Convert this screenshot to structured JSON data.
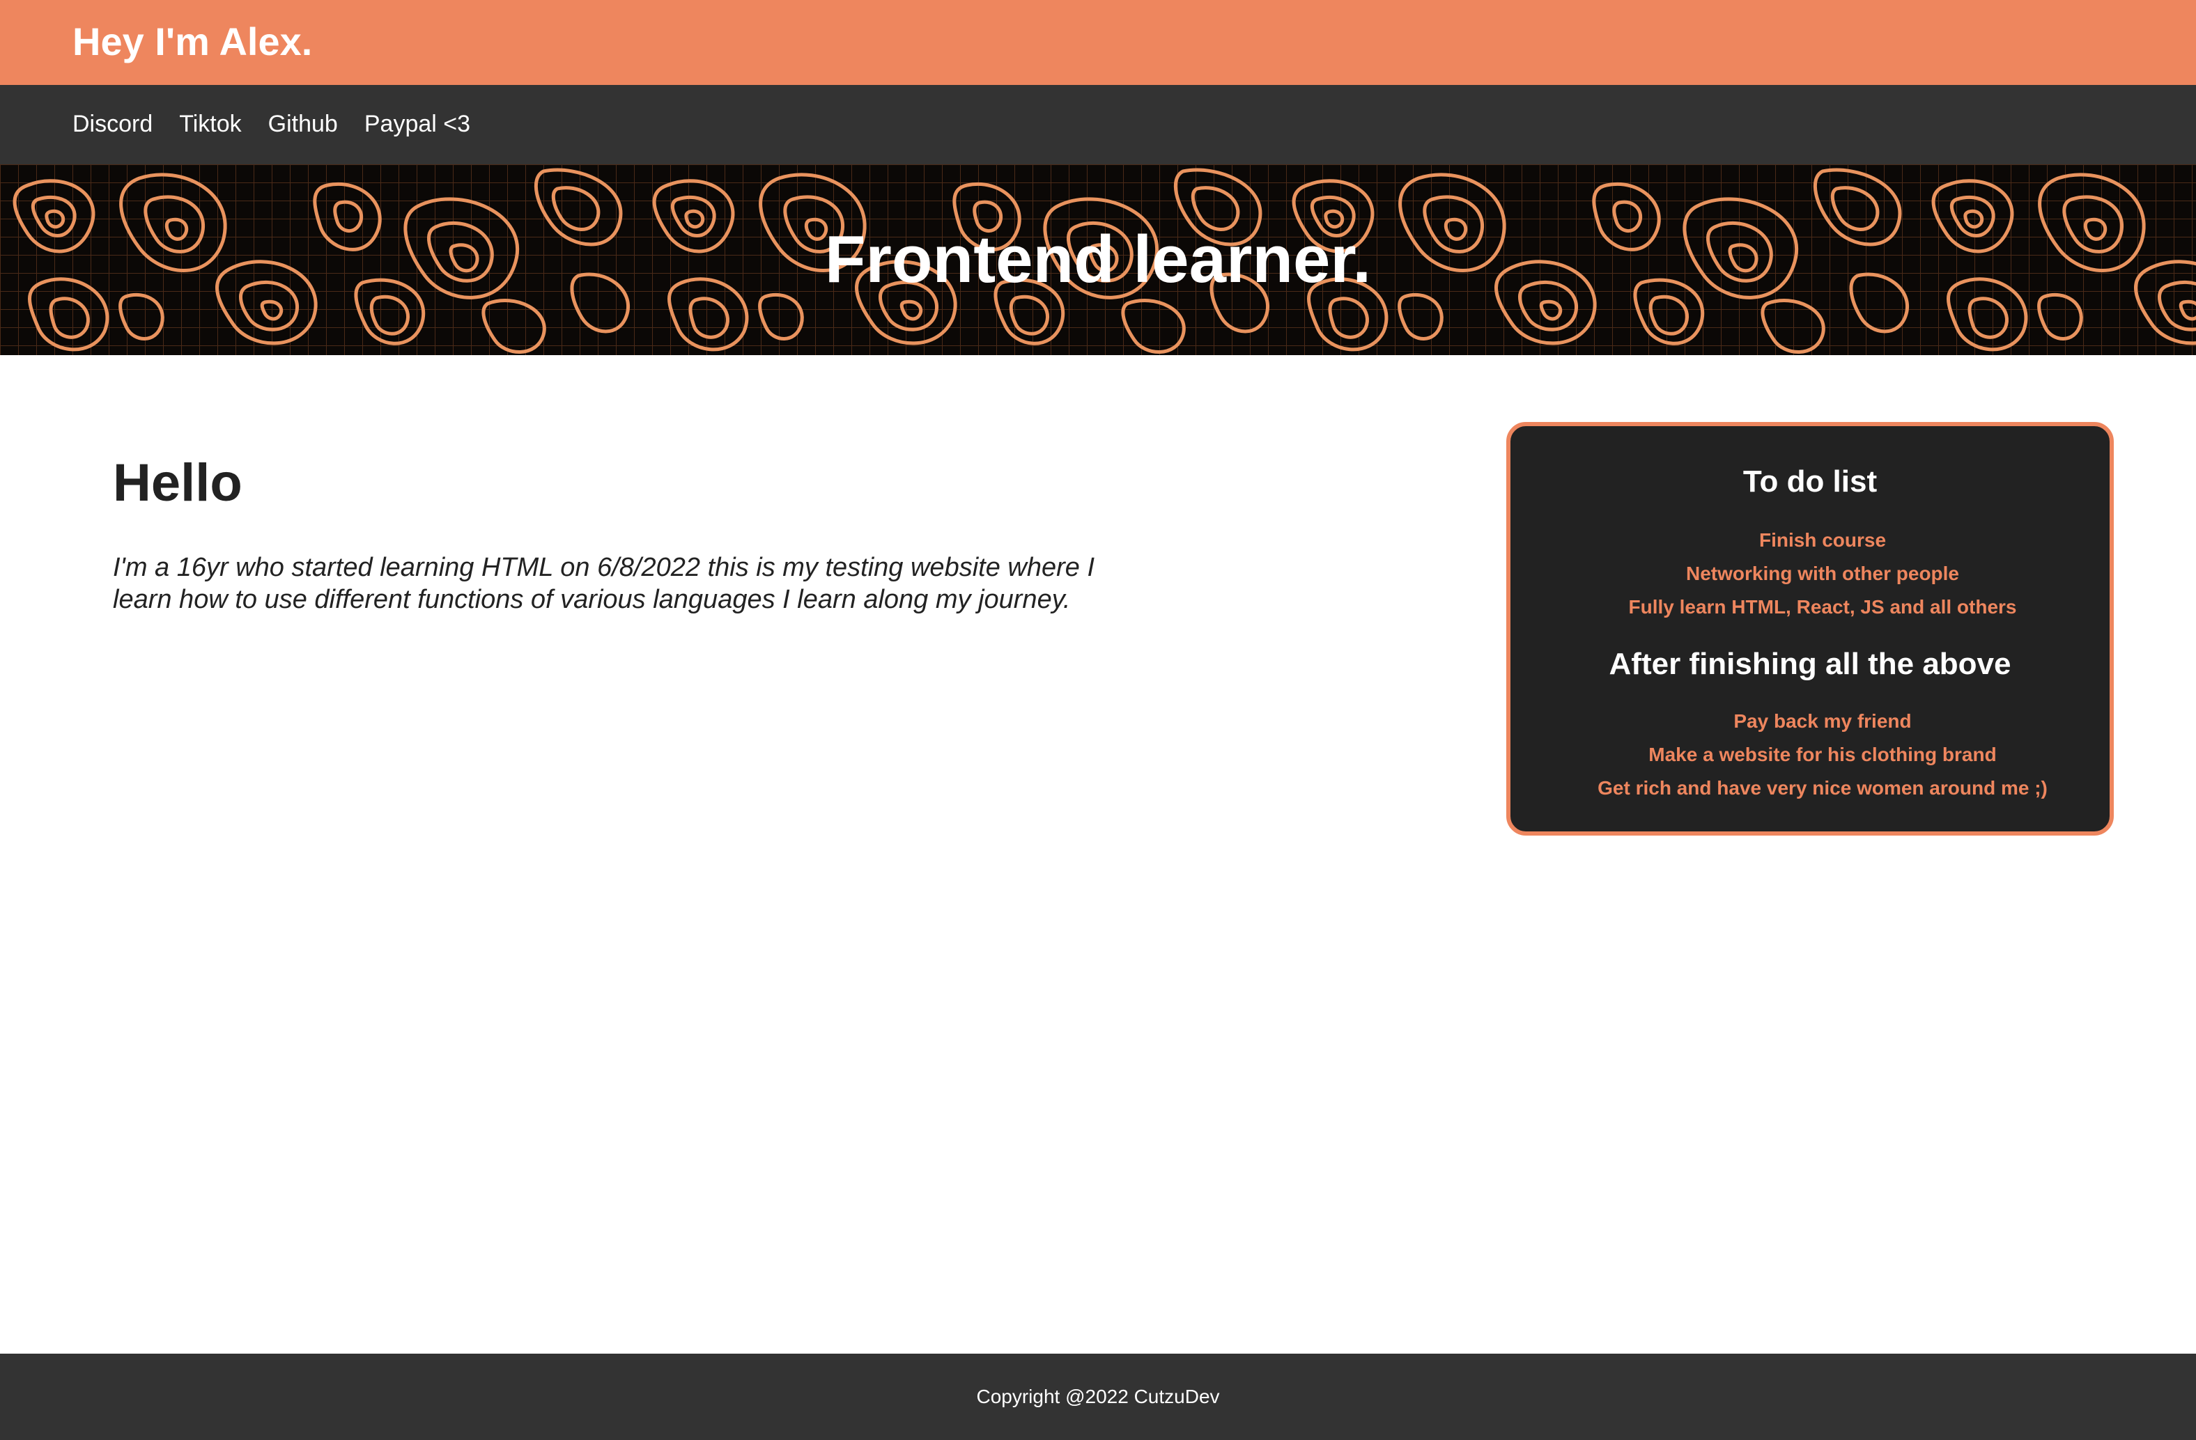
{
  "header": {
    "title": "Hey I'm Alex."
  },
  "nav": {
    "links": [
      {
        "label": "Discord"
      },
      {
        "label": "Tiktok"
      },
      {
        "label": "Github"
      },
      {
        "label": "Paypal <3"
      }
    ]
  },
  "hero": {
    "title": "Frontend learner."
  },
  "intro": {
    "heading": "Hello",
    "text": "I'm a 16yr who started learning HTML on 6/8/2022 this is my testing website where I learn how to use different functions of various languages I learn along my journey."
  },
  "todo": {
    "title": "To do list",
    "items": [
      "Finish course",
      "Networking with other people",
      "Fully learn HTML, React, JS and all others"
    ],
    "after_title": "After finishing all the above",
    "after_items": [
      "Pay back my friend",
      "Make a website for his clothing brand",
      "Get rich and have very nice women around me ;)"
    ]
  },
  "footer": {
    "copyright": "Copyright @2022 CutzuDev"
  },
  "colors": {
    "accent": "#ee865e",
    "nav_background": "#333333",
    "card_background": "#222222",
    "hero_background": "#0b0806"
  }
}
